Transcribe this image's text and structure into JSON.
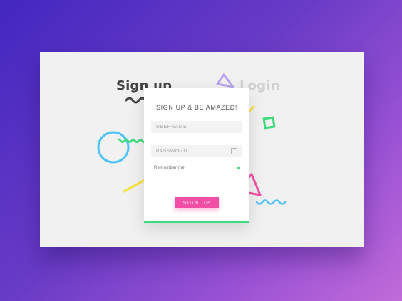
{
  "tabs": {
    "signup_label": "Sign up",
    "login_label": "Login"
  },
  "form": {
    "title": "SIGN UP & BE AMAZED!",
    "username_placeholder": "USERNAME",
    "password_placeholder": "PASSWORD",
    "help_icon_glyph": "?",
    "remember_label": "Remember me",
    "submit_label": "SIGN UP"
  },
  "colors": {
    "accent_pink": "#f14ea6",
    "accent_green": "#3ddc7e",
    "accent_blue": "#4fc3f7",
    "accent_yellow": "#f6e23c",
    "purple_triangle": "#b9a6ec",
    "gradient_start": "#4327c0",
    "gradient_end": "#c16bd9"
  },
  "icons": {
    "help": "question-mark-box-icon",
    "remember_indicator": "remember-dot-icon",
    "tab_underline": "squiggle-underline-icon"
  }
}
